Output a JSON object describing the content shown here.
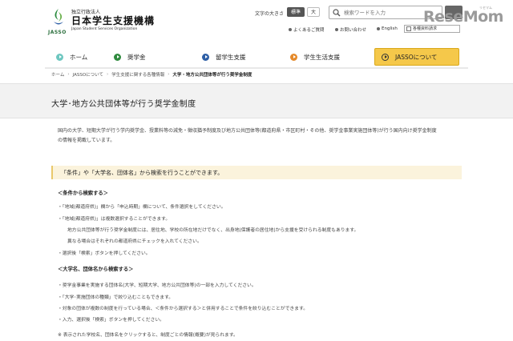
{
  "header": {
    "org_sub": "独立行政法人",
    "org_main": "日本学生支援機構",
    "org_en": "Japan Student Services Organization",
    "logo_text": "JASSO",
    "font_size_label": "文字の大きさ",
    "font_standard": "標準",
    "font_large": "大",
    "search_placeholder": "検索ワードを入力",
    "links": [
      "よくあるご質問",
      "お問い合わせ",
      "English"
    ],
    "doc_request": "各種資料請求",
    "watermark": "ReseMom",
    "watermark_sub": "リセマム"
  },
  "nav": {
    "items": [
      "ホーム",
      "奨学金",
      "留学生支援",
      "学生生活支援",
      "JASSOについて"
    ]
  },
  "breadcrumb": [
    "ホーム",
    "JASSOについて",
    "学生支援に関する各種情報",
    "大学・地方公共団体等が行う奨学金制度"
  ],
  "page": {
    "title": "大学･地方公共団体等が行う奨学金制度",
    "intro_1": "国内の大学、短期大学が行う学内奨学金、授業料等の減免・徴収猶予制度及び地方公共団体等(都道府県・市区町村・その他、奨学金事業実施団体等)が行う国内向け奨学金制度",
    "intro_2": "の情報を掲載しています。",
    "notice": "「条件」や「大学名、団体名」から検索を行うことができます。",
    "section1_head": "＜条件から検索する＞",
    "section1_lines": [
      "・「地域(都道府県)」欄から「申込時期」欄について、条件選択をしてください。",
      "・「地域(都道府県)」は複数選択することができます。",
      "地方公共団体等が行う奨学金制度には、居住地、学校の所在地だけでなく、出身地(保護者の居住地)から支援を受けられる制度もあります。",
      "異なる場合はそれぞれの都道府県にチェックを入れてください。",
      "・選択後「検索」ボタンを押してください。"
    ],
    "section2_head": "＜大学名、団体名から検索する＞",
    "section2_lines": [
      "・奨学金事業を実施する団体名(大学、短期大学、地方公共団体等)の一部を入力してください。",
      "・「大学･実施団体の種類」で絞り込むこともできます。",
      "・対象の団体が複数の制度を行っている場合、＜条件から選択する＞と併用することで条件を絞り込むことができます。",
      "・入力、選択後「検索」ボタンを押してください。"
    ],
    "footnote": "※ 表示された学校名、団体名をクリックすると、制度ごとの情報(概要)が見られます。"
  }
}
